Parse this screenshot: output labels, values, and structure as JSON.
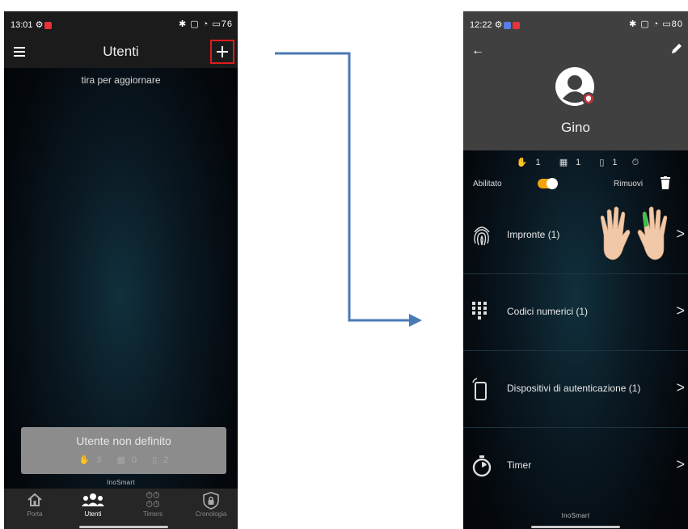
{
  "left_screen": {
    "status": {
      "time": "13:01",
      "icons": "✱ ▢ ◔ ▭76"
    },
    "appbar": {
      "title": "Utenti"
    },
    "pull_hint": "tira per aggiornare",
    "user_card": {
      "name": "Utente non definito",
      "fingerprints": "3",
      "codes": "0",
      "devices": "2"
    },
    "brand": "InoSmart",
    "nav": [
      {
        "label": "Porta",
        "icon": "home-icon"
      },
      {
        "label": "Utenti",
        "icon": "users-icon"
      },
      {
        "label": "Timers",
        "icon": "timers-icon"
      },
      {
        "label": "Cronologia",
        "icon": "lock-history-icon"
      }
    ]
  },
  "right_screen": {
    "status": {
      "time": "12:22",
      "icons": "✱ ▢ ◔ ▭80"
    },
    "profile": {
      "name": "Gino"
    },
    "counts": {
      "fingerprints": "1",
      "codes": "1",
      "devices": "1"
    },
    "enabled_label": "Abilitato",
    "enabled": true,
    "remove_label": "Rimuovi",
    "rows": [
      {
        "label": "Impronte (1)",
        "icon": "fingerprint-icon"
      },
      {
        "label": "Codici numerici (1)",
        "icon": "keypad-icon"
      },
      {
        "label": "Dispositivi di autenticazione (1)",
        "icon": "phone-icon"
      },
      {
        "label": "Timer",
        "icon": "stopwatch-icon"
      }
    ],
    "brand": "InoSmart"
  },
  "colors": {
    "accent_toggle": "#f2a20c",
    "highlight": "#e01b1b",
    "arrow": "#4a7ab6",
    "finger_highlight": "#39c24a"
  }
}
